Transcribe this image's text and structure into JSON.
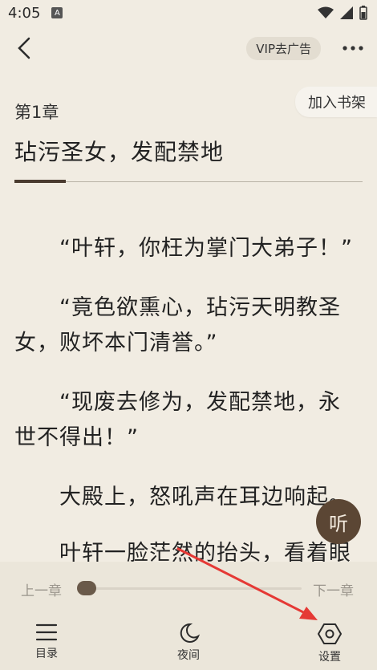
{
  "status": {
    "time": "4:05",
    "a_badge": "A"
  },
  "nav": {
    "vip_label": "VIP去广告"
  },
  "reader": {
    "chapter_number": "第1章",
    "chapter_title": "玷污圣女，发配禁地",
    "add_shelf": "加入书架",
    "paragraphs": [
      "“叶轩，你枉为掌门大弟子！”",
      "“竟色欲熏心，玷污天明教圣女，败坏本门清誉。”",
      "“现废去修为，发配禁地，永世不得出！”",
      "大殿上，怒吼声在耳边响起。",
      "叶轩一脸茫然的抬头，看着眼"
    ],
    "listen_label": "听"
  },
  "progress": {
    "prev_label": "上一章",
    "next_label": "下一章",
    "value": 0.0
  },
  "tabs": {
    "catalog": "目录",
    "night": "夜间",
    "settings": "设置"
  },
  "colors": {
    "background": "#f1ece2",
    "accent": "#5b4634",
    "arrow": "#e53935"
  }
}
